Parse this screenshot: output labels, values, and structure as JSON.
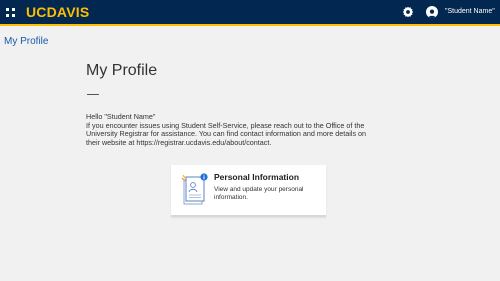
{
  "header": {
    "logo": "UCDAVIS",
    "user_name": "\"Student Name\""
  },
  "breadcrumb": "My Profile",
  "main": {
    "title": "My Profile",
    "intro_lines": [
      "Hello \"Student Name\"",
      "If you encounter issues using Student Self-Service, please reach out to the Office of the",
      "University Registrar for assistance. You can find contact information and more details on",
      "their website at https://registrar.ucdavis.edu/about/contact."
    ]
  },
  "card": {
    "title": "Personal Information",
    "description": "View and update your personal information.",
    "icon": "profile-document-info-icon"
  },
  "colors": {
    "topbar": "#022851",
    "accent": "#ffbf00",
    "link": "#1a5aa8"
  }
}
